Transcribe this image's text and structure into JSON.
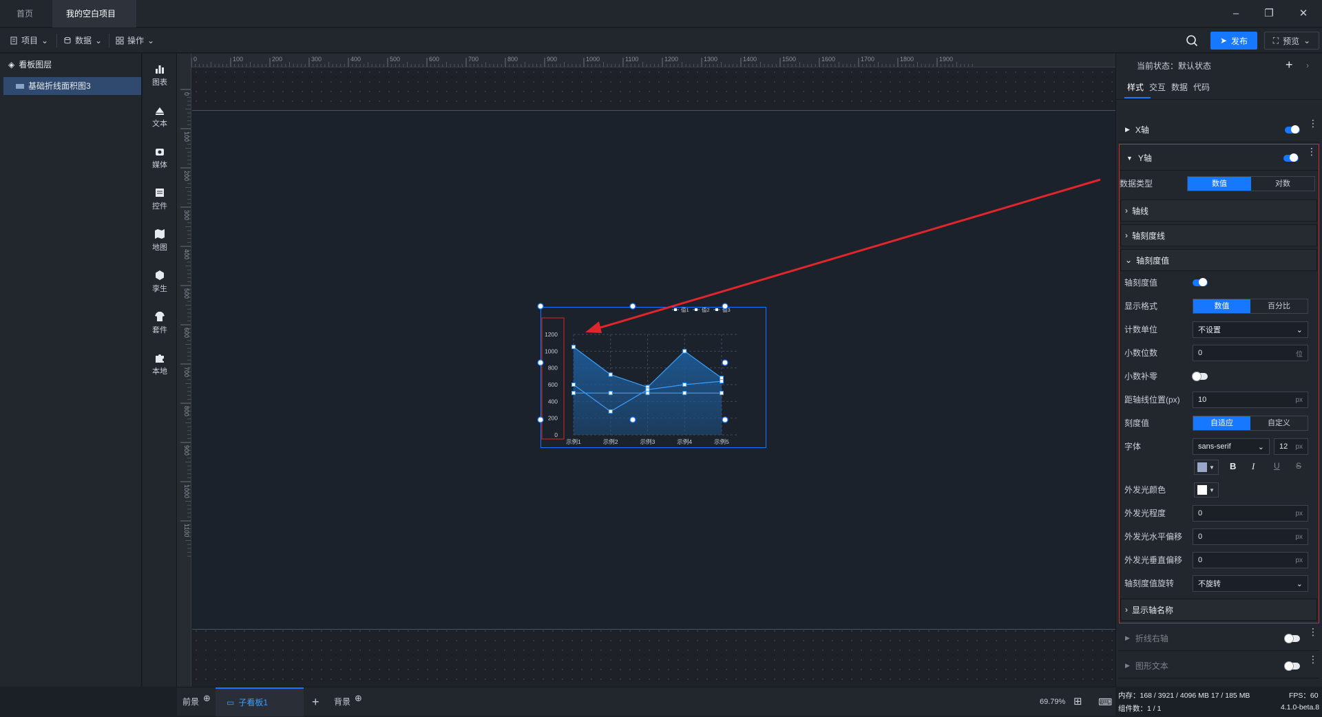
{
  "titlebar": {
    "tabs": [
      {
        "label": "首页"
      },
      {
        "label": "我的空白项目"
      }
    ]
  },
  "toolbar": {
    "menus": [
      {
        "label": "项目"
      },
      {
        "label": "数据"
      },
      {
        "label": "操作"
      }
    ],
    "publish_label": "发布",
    "preview_label": "预览"
  },
  "layers": {
    "title": "看板图层",
    "items": [
      {
        "label": "基础折线面积图3"
      }
    ]
  },
  "components": [
    {
      "label": "图表",
      "icon": "bar-chart-icon"
    },
    {
      "label": "文本",
      "icon": "text-icon"
    },
    {
      "label": "媒体",
      "icon": "media-icon"
    },
    {
      "label": "控件",
      "icon": "control-icon"
    },
    {
      "label": "地图",
      "icon": "map-icon"
    },
    {
      "label": "孪生",
      "icon": "twin-icon"
    },
    {
      "label": "套件",
      "icon": "kit-icon"
    },
    {
      "label": "本地",
      "icon": "puzzle-icon"
    }
  ],
  "ruler": {
    "top_ticks": [
      "0",
      "100",
      "200",
      "300",
      "400",
      "500",
      "600",
      "700",
      "800",
      "900",
      "1000",
      "1100",
      "1200",
      "1300",
      "1400",
      "1500",
      "1600",
      "1700",
      "1800",
      "1900"
    ],
    "left_ticks": [
      "0",
      "100",
      "200",
      "300",
      "400",
      "500",
      "600",
      "700",
      "800",
      "900",
      "1000",
      "1100"
    ]
  },
  "bottombar": {
    "foreground": "前景",
    "board": "子看板1",
    "background": "背景",
    "zoom": "69.79%"
  },
  "props": {
    "state_label": "当前状态：默认状态",
    "tabs": [
      {
        "label": "样式"
      },
      {
        "label": "交互"
      },
      {
        "label": "数据"
      },
      {
        "label": "代码"
      }
    ],
    "x_axis": "X轴",
    "y_axis": "Y轴",
    "data_type": {
      "label": "数据类型",
      "options": [
        "数值",
        "对数"
      ]
    },
    "axis_line": "轴线",
    "axis_tick_line": "轴刻度线",
    "axis_tick_value": "轴刻度值",
    "rows": {
      "tick_value": "轴刻度值",
      "format": {
        "label": "显示格式",
        "options": [
          "数值",
          "百分比"
        ]
      },
      "unit": {
        "label": "计数单位",
        "value": "不设置"
      },
      "decimals": {
        "label": "小数位数",
        "value": "0",
        "unit": "位"
      },
      "zero_pad": "小数补零",
      "distance": {
        "label": "距轴线位置(px)",
        "value": "10",
        "unit": "px"
      },
      "tick": {
        "label": "刻度值",
        "options": [
          "自适应",
          "自定义"
        ]
      },
      "font": {
        "label": "字体",
        "family": "sans-serif",
        "size": "12",
        "unit": "px"
      },
      "glow_color": "外发光颜色",
      "glow_level": {
        "label": "外发光程度",
        "value": "0",
        "unit": "px"
      },
      "glow_h": {
        "label": "外发光水平偏移",
        "value": "0",
        "unit": "px"
      },
      "glow_v": {
        "label": "外发光垂直偏移",
        "value": "0",
        "unit": "px"
      },
      "rotate": {
        "label": "轴刻度值旋转",
        "value": "不旋转"
      }
    },
    "show_axis_name": "显示轴名称",
    "right_axis": "折线右轴",
    "graphic_text": "图形文本"
  },
  "status": {
    "memory": "内存：168 / 3921 / 4096 MB  17 / 185 MB",
    "fps": "FPS：60",
    "components": "组件数：1 / 1",
    "version": "4.1.0-beta.8"
  },
  "chart_data": {
    "type": "area",
    "categories": [
      "示例1",
      "示例2",
      "示例3",
      "示例4",
      "示例5"
    ],
    "series": [
      {
        "name": "值1",
        "values": [
          1050,
          720,
          570,
          1000,
          680
        ]
      },
      {
        "name": "值2",
        "values": [
          600,
          280,
          540,
          600,
          640
        ]
      },
      {
        "name": "值3",
        "values": [
          500,
          500,
          500,
          500,
          500
        ]
      }
    ],
    "ylim": [
      0,
      1200
    ],
    "yticks": [
      "0",
      "200",
      "400",
      "600",
      "800",
      "1000",
      "1200"
    ],
    "legend": "top-right",
    "grid": true,
    "colors": {
      "line": "#3aa0ff",
      "area": "#1d5a96",
      "accent": "#1677ff",
      "highlight": "#d62b2b"
    }
  }
}
